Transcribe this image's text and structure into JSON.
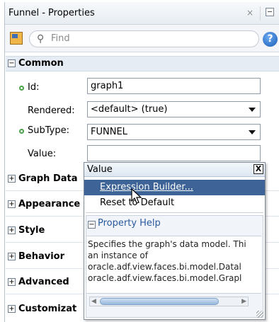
{
  "window": {
    "title": "Funnel - Properties",
    "close_glyph": "×"
  },
  "toolbar": {
    "bind_icon": "bind-to-data-icon",
    "search_placeholder": "Find",
    "help_glyph": "?"
  },
  "sections": {
    "common": "Common",
    "graph_data": "Graph Data",
    "appearance": "Appearance",
    "style": "Style",
    "behavior": "Behavior",
    "advanced": "Advanced",
    "customization": "Customizat"
  },
  "properties": {
    "id": {
      "label": "Id:",
      "value": "graph1"
    },
    "rendered": {
      "label": "Rendered:",
      "value": "<default> (true)"
    },
    "subtype": {
      "label": "SubType:",
      "value": "FUNNEL"
    },
    "value": {
      "label": "Value:",
      "value": ""
    }
  },
  "popup": {
    "title": "Value",
    "close_glyph": "X",
    "items": [
      {
        "label": "Expression Builder...",
        "selected": true
      },
      {
        "label": "Reset to Default",
        "selected": false
      }
    ],
    "help_title": "Property Help",
    "help_lines": [
      "Specifies the graph's data model. Thi",
      "an instance of",
      "oracle.adf.view.faces.bi.model.Datal",
      "oracle.adf.view.faces.bi.model.Grapl"
    ]
  },
  "colors": {
    "selection": "#3d6397",
    "required_dot": "#4aa24a",
    "help_link": "#2a5aa0"
  }
}
